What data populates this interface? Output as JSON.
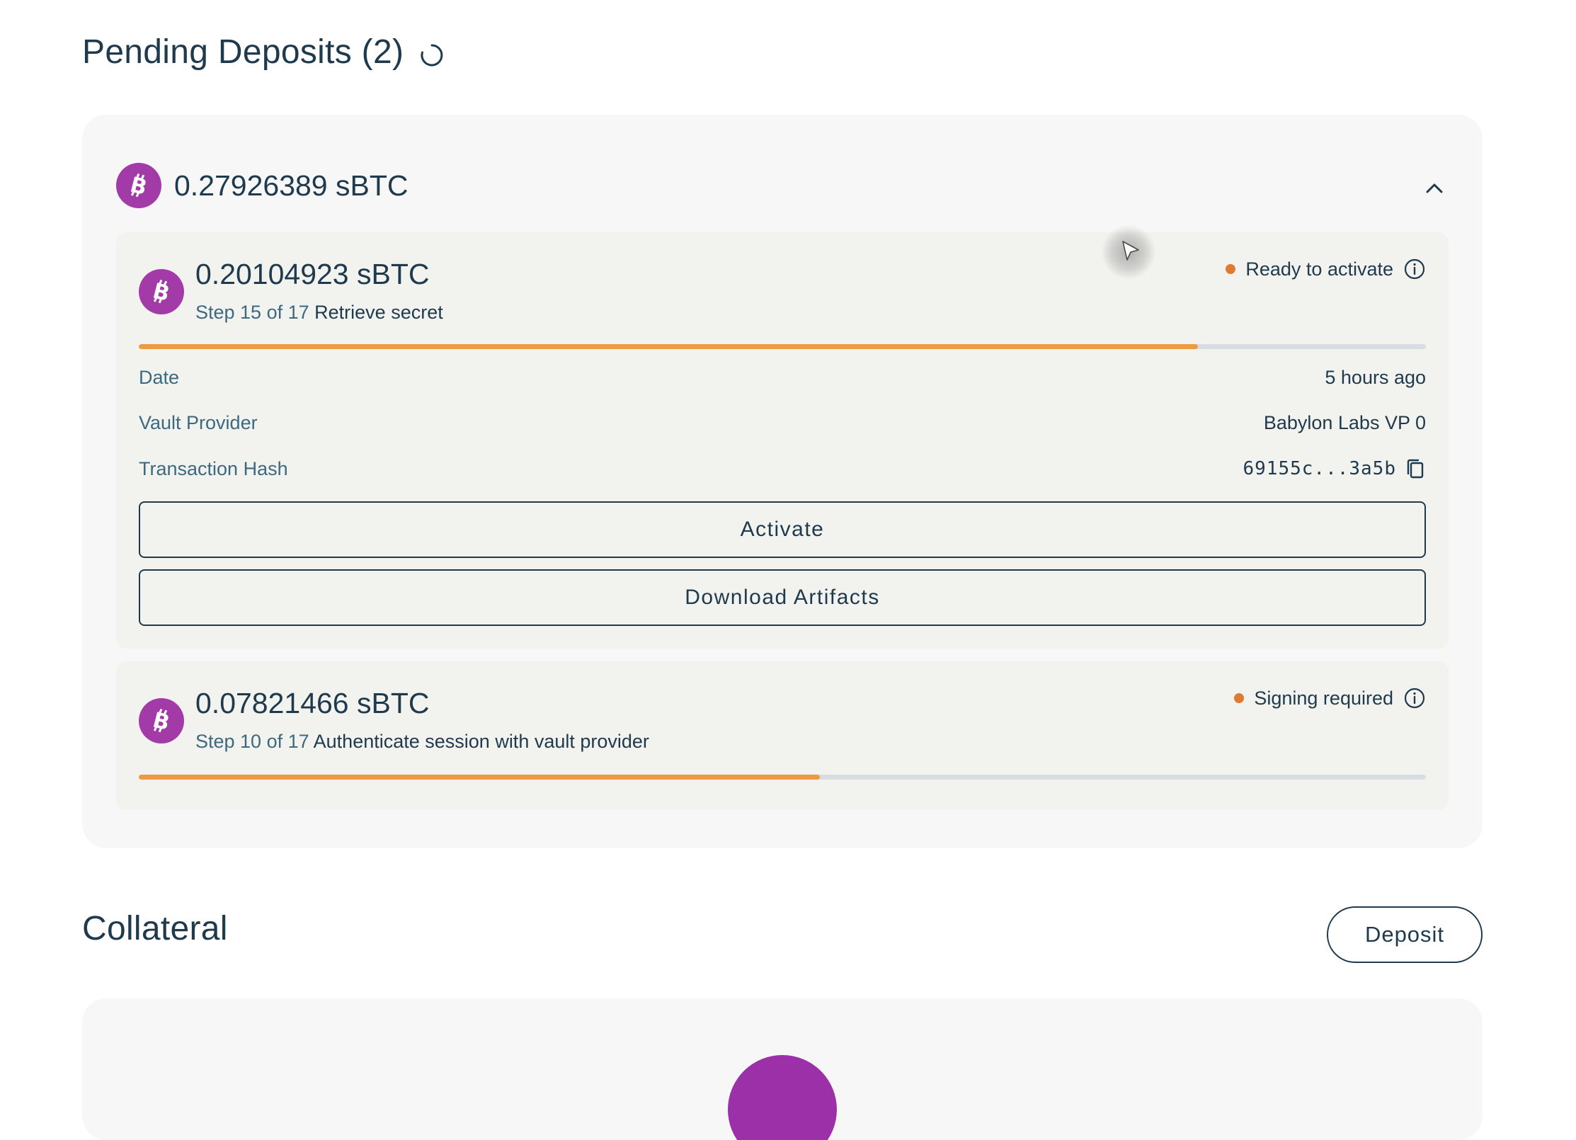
{
  "pending": {
    "title": "Pending Deposits (2)",
    "group": {
      "amount": "0.27926389 sBTC",
      "deposits": [
        {
          "amount": "0.20104923 sBTC",
          "step_prefix": "Step 15 of 17",
          "step_desc": "Retrieve secret",
          "status": "Ready to activate",
          "progress": 0.823,
          "details": [
            {
              "label": "Date",
              "value": "5 hours ago"
            },
            {
              "label": "Vault Provider",
              "value": "Babylon Labs VP 0"
            },
            {
              "label": "Transaction Hash",
              "value": "69155c...3a5b"
            }
          ],
          "actions": {
            "activate": "Activate",
            "download": "Download Artifacts"
          }
        },
        {
          "amount": "0.07821466 sBTC",
          "step_prefix": "Step 10 of 17",
          "step_desc": "Authenticate session with vault provider",
          "status": "Signing required",
          "progress": 0.529
        }
      ]
    }
  },
  "collateral": {
    "title": "Collateral",
    "deposit_button": "Deposit"
  },
  "icons": {
    "spinner": "loading-spinner-icon",
    "chevron": "chevron-up-icon",
    "bitcoin": "bitcoin-icon",
    "info": "info-icon",
    "copy": "copy-icon",
    "cursor": "cursor-pointer-icon"
  },
  "colors": {
    "brand_purple": "#a23aa8",
    "progress_fill": "#ee9a43",
    "status_dot": "#e07a2e",
    "text_primary": "#1f3a4d"
  }
}
